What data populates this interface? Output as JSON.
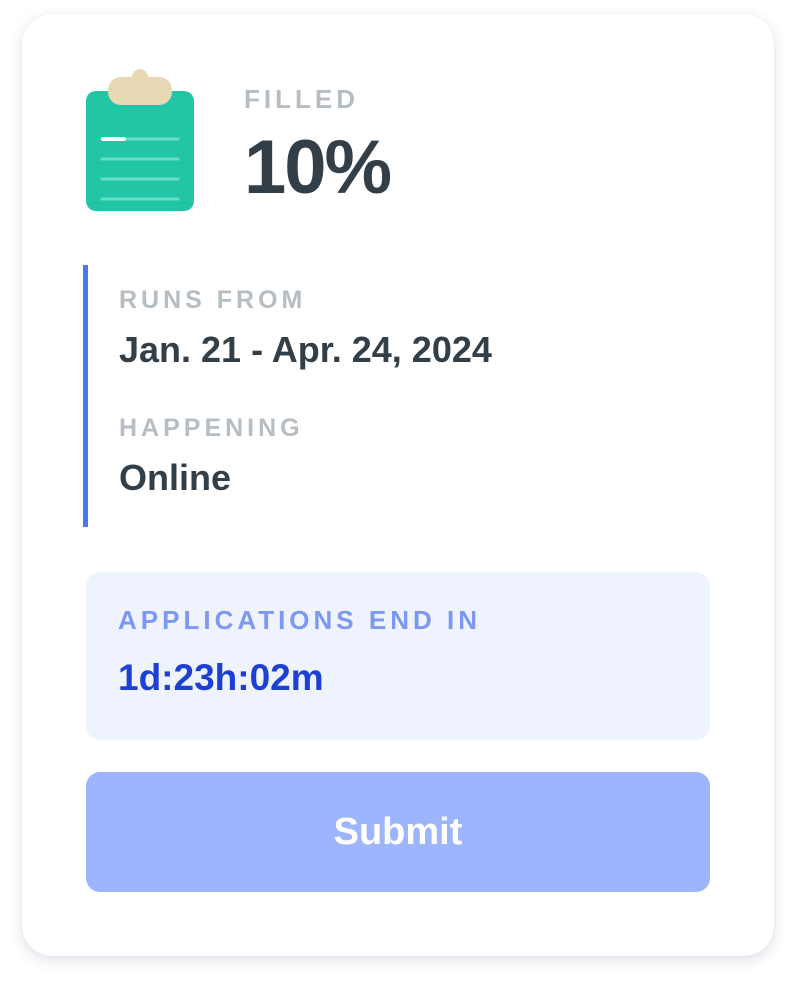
{
  "status": {
    "filled_label": "FILLED",
    "filled_value": "10%"
  },
  "schedule": {
    "runs_from_label": "RUNS FROM",
    "runs_from_value": "Jan. 21 - Apr. 24, 2024",
    "happening_label": "HAPPENING",
    "happening_value": "Online"
  },
  "deadline": {
    "label": "APPLICATIONS END IN",
    "countdown": "1d:23h:02m"
  },
  "actions": {
    "submit_label": "Submit"
  },
  "icons": {
    "status_icon": "clipboard-icon"
  },
  "colors": {
    "accent_blue": "#4778f4",
    "countdown_blue": "#1c3fd4",
    "clipboard_green": "#22c6a7",
    "submit_disabled": "#9cb5fc"
  }
}
